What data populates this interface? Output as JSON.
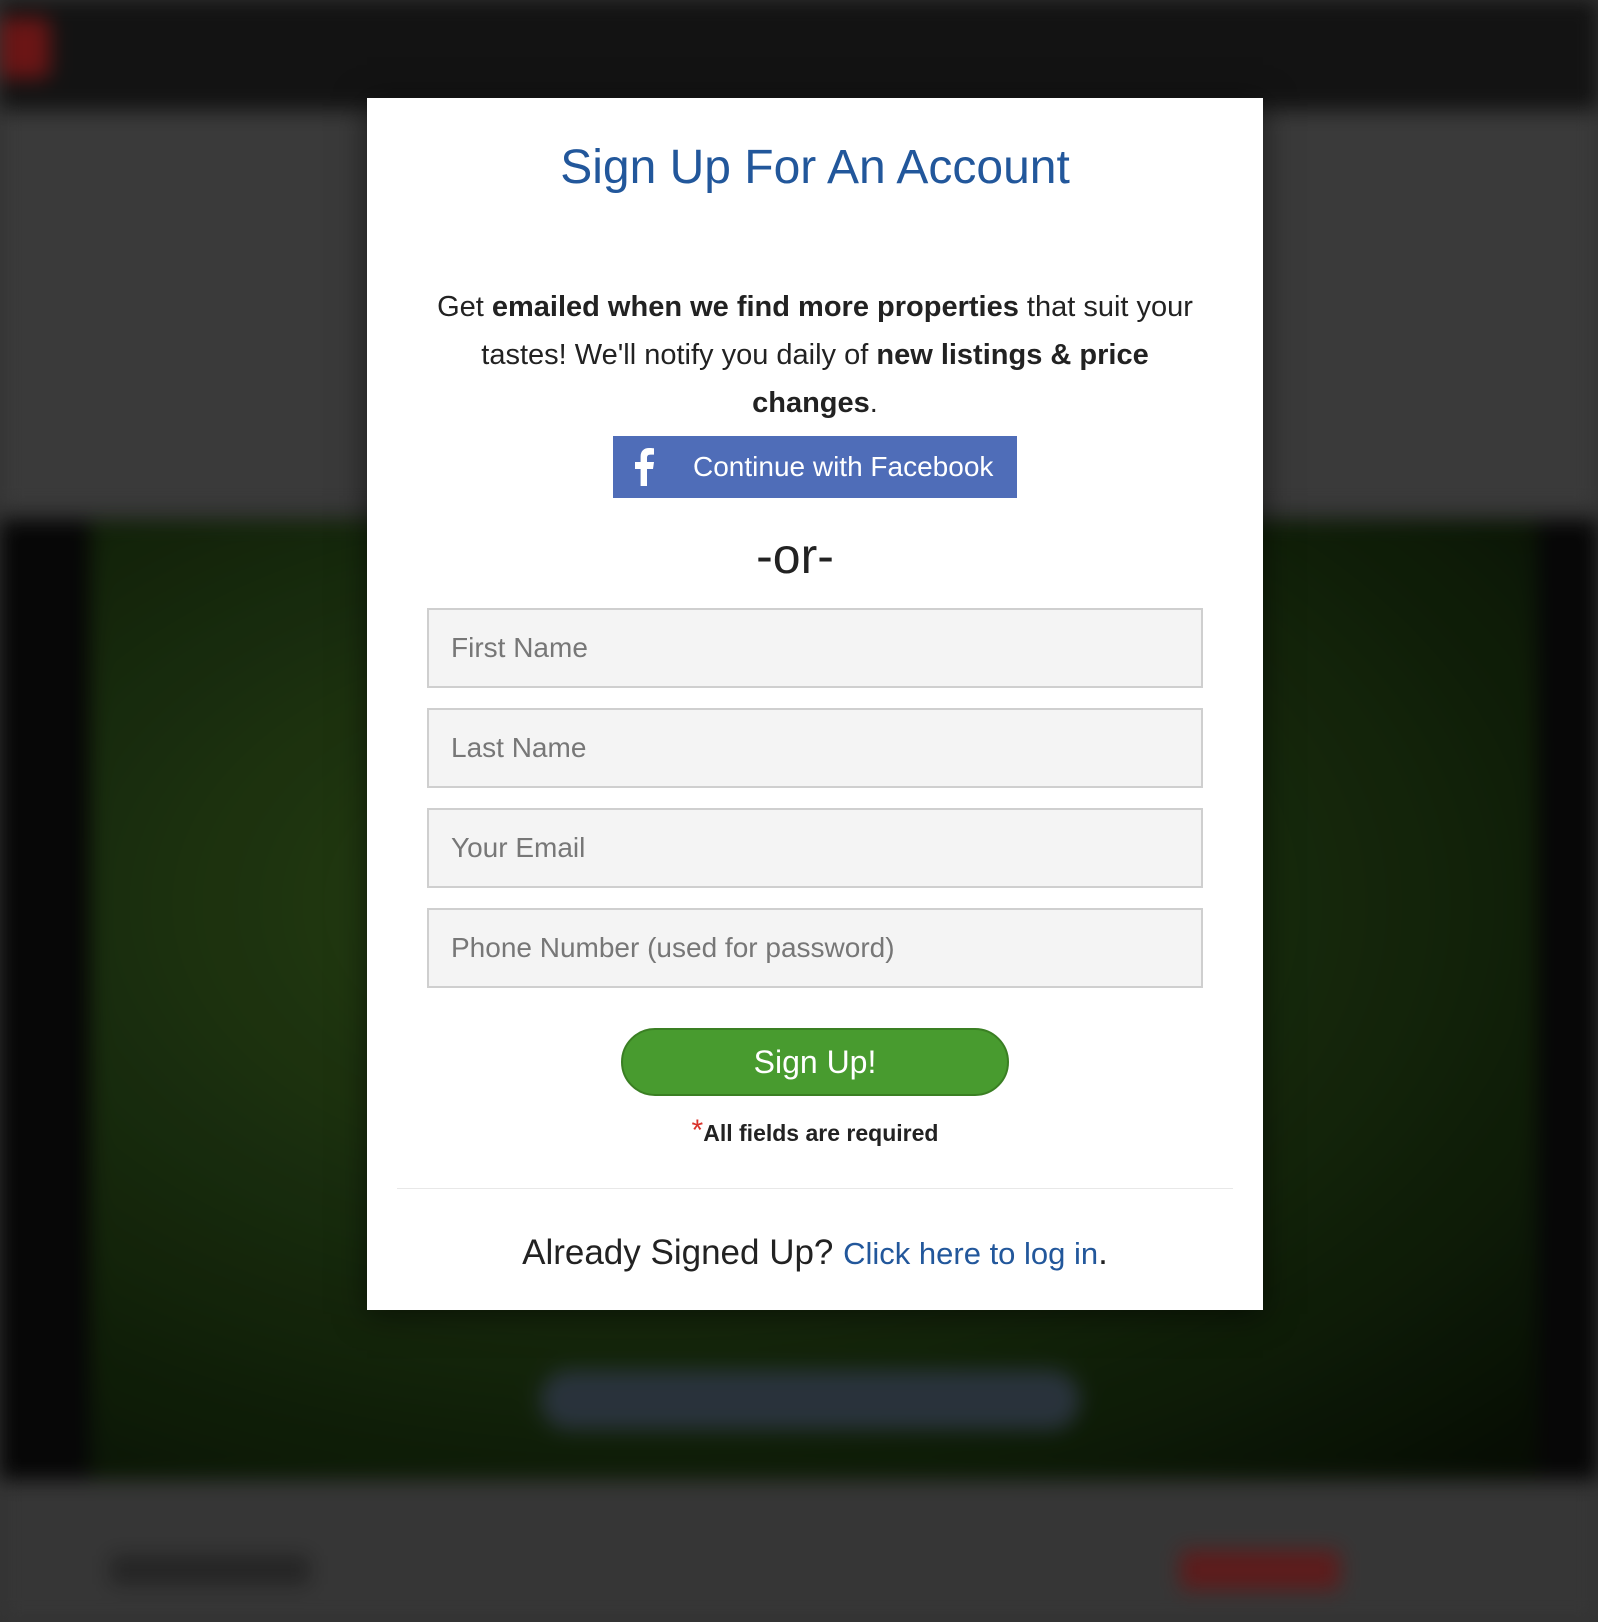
{
  "modal": {
    "title": "Sign Up For An Account",
    "intro": {
      "part1": "Get ",
      "bold1": "emailed when we find more properties",
      "part2": " that suit your tastes! We'll notify you daily of ",
      "bold2": "new listings & price changes",
      "part3": "."
    },
    "facebook_button": {
      "icon": "facebook-icon",
      "label": "Continue with Facebook",
      "color": "#4f6db8"
    },
    "separator": "-or-",
    "fields": {
      "first_name_placeholder": "First Name",
      "last_name_placeholder": "Last Name",
      "email_placeholder": "Your Email",
      "phone_placeholder": "Phone Number (used for password)"
    },
    "submit_label": "Sign Up!",
    "submit_color": "#489b2f",
    "required_note": {
      "star": "*",
      "text": "All fields are required"
    },
    "login": {
      "prompt": "Already Signed Up?",
      "link_label": "Click here to log in",
      "suffix": "."
    },
    "accent_color": "#22579b"
  }
}
